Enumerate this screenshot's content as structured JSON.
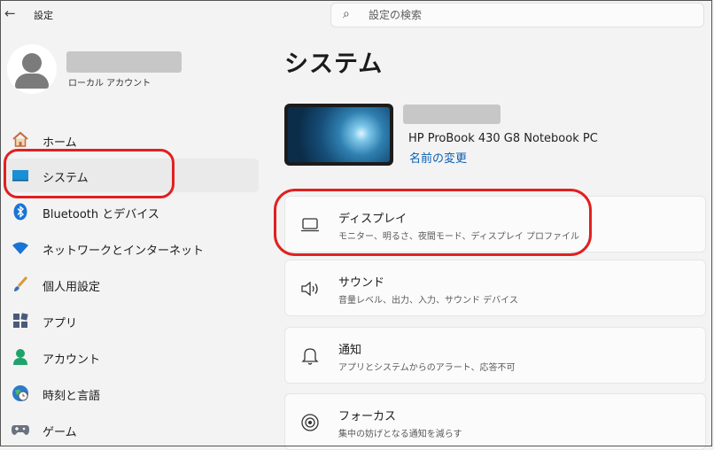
{
  "window": {
    "back_icon": "←",
    "title": "設定",
    "search_placeholder": "設定の検索",
    "search_icon": "⌕"
  },
  "profile": {
    "account_type": "ローカル アカウント"
  },
  "sidebar": {
    "items": [
      {
        "label": "ホーム",
        "icon": "home-icon",
        "active": false
      },
      {
        "label": "システム",
        "icon": "system-icon",
        "active": true
      },
      {
        "label": "Bluetooth とデバイス",
        "icon": "bluetooth-icon",
        "active": false
      },
      {
        "label": "ネットワークとインターネット",
        "icon": "wifi-icon",
        "active": false
      },
      {
        "label": "個人用設定",
        "icon": "brush-icon",
        "active": false
      },
      {
        "label": "アプリ",
        "icon": "apps-icon",
        "active": false
      },
      {
        "label": "アカウント",
        "icon": "account-icon",
        "active": false
      },
      {
        "label": "時刻と言語",
        "icon": "globe-icon",
        "active": false
      },
      {
        "label": "ゲーム",
        "icon": "gamepad-icon",
        "active": false
      }
    ]
  },
  "main": {
    "heading": "システム",
    "device": {
      "model": "HP ProBook 430 G8 Notebook PC",
      "rename_link": "名前の変更"
    },
    "cards": [
      {
        "title": "ディスプレイ",
        "subtitle": "モニター、明るさ、夜間モード、ディスプレイ プロファイル",
        "icon": "display-icon"
      },
      {
        "title": "サウンド",
        "subtitle": "音量レベル、出力、入力、サウンド デバイス",
        "icon": "speaker-icon"
      },
      {
        "title": "通知",
        "subtitle": "アプリとシステムからのアラート、応答不可",
        "icon": "bell-icon"
      },
      {
        "title": "フォーカス",
        "subtitle": "集中の妨げとなる通知を減らす",
        "icon": "focus-icon"
      }
    ]
  },
  "colors": {
    "accent": "#0067c0",
    "link": "#0b5fb3",
    "annotation_red": "#e02020"
  }
}
